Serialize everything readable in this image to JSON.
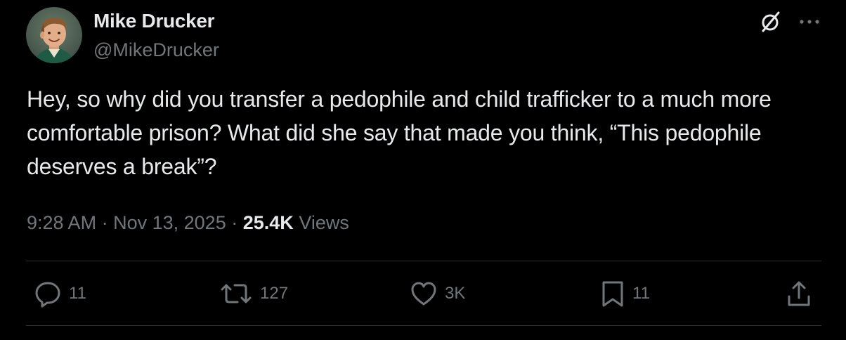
{
  "author": {
    "display_name": "Mike Drucker",
    "handle": "@MikeDrucker"
  },
  "top_actions": {
    "grok_icon": "slash-circle-icon",
    "more_icon": "more-dots-icon"
  },
  "tweet": {
    "text": "Hey, so why did you transfer a pedophile and child trafficker to a much more comfortable prison? What did she say that made you think, “This pedophile deserves a break”?"
  },
  "meta": {
    "time": "9:28 AM",
    "separator": "·",
    "date": "Nov 13, 2025",
    "views_count": "25.4K",
    "views_label": "Views"
  },
  "actions": {
    "replies": "11",
    "reposts": "127",
    "likes": "3K",
    "bookmarks": "11"
  },
  "colors": {
    "background": "#000000",
    "text": "#e7e9ea",
    "secondary": "#71767b",
    "divider": "#2f3336"
  }
}
